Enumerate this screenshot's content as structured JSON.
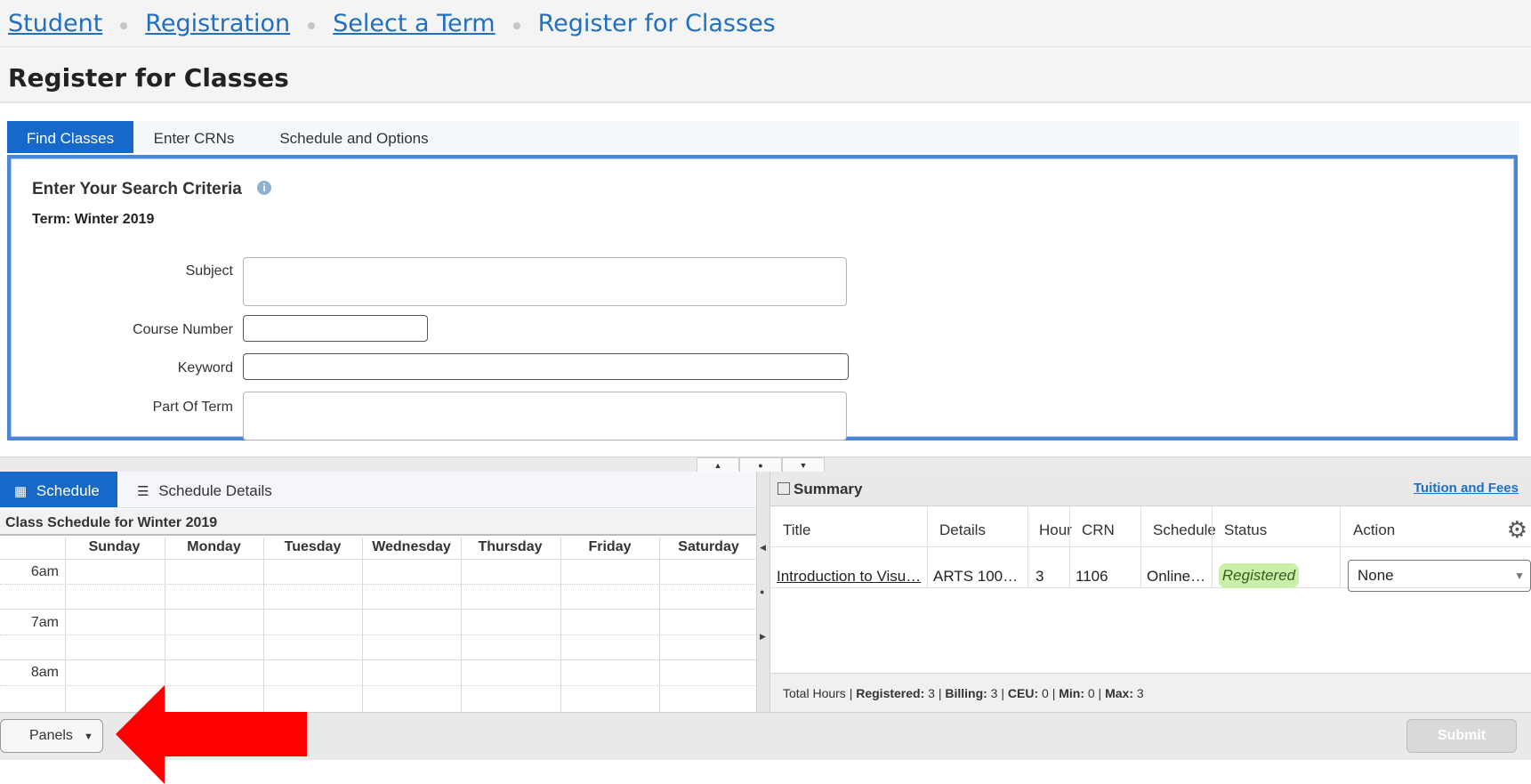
{
  "breadcrumb": {
    "items": [
      "Student",
      "Registration",
      "Select a Term",
      "Register for Classes"
    ]
  },
  "page": {
    "title": "Register for Classes"
  },
  "tabs": [
    {
      "label": "Find Classes",
      "active": true
    },
    {
      "label": "Enter CRNs",
      "active": false
    },
    {
      "label": "Schedule and Options",
      "active": false
    }
  ],
  "search": {
    "title": "Enter Your Search Criteria",
    "info_icon": "info-icon",
    "term": "Term: Winter 2019",
    "fields": {
      "subject": {
        "label": "Subject",
        "value": ""
      },
      "course_number": {
        "label": "Course Number",
        "value": ""
      },
      "keyword": {
        "label": "Keyword",
        "value": ""
      },
      "part_of_term": {
        "label": "Part Of Term",
        "value": ""
      }
    }
  },
  "schedule": {
    "tabs": [
      {
        "label": "Schedule",
        "icon": "calendar-icon",
        "active": true
      },
      {
        "label": "Schedule Details",
        "icon": "list-icon",
        "active": false
      }
    ],
    "title": "Class Schedule for Winter 2019",
    "days": [
      "Sunday",
      "Monday",
      "Tuesday",
      "Wednesday",
      "Thursday",
      "Friday",
      "Saturday"
    ],
    "times": [
      "6am",
      "7am",
      "8am"
    ]
  },
  "summary": {
    "title": "Summary",
    "tuition_link": "Tuition and Fees",
    "columns": [
      "Title",
      "Details",
      "Hour",
      "CRN",
      "Schedule",
      "Status",
      "Action"
    ],
    "rows": [
      {
        "title": "Introduction to Visu…",
        "details": "ARTS 100…",
        "hours": "3",
        "crn": "1106",
        "schedule": "Online…",
        "status": "Registered",
        "action": "None"
      }
    ],
    "totals": {
      "prefix": "Total Hours | ",
      "registered_label": "Registered:",
      "registered": " 3 | ",
      "billing_label": "Billing:",
      "billing": " 3 | ",
      "ceu_label": "CEU:",
      "ceu": " 0 | ",
      "min_label": "Min:",
      "min": " 0 | ",
      "max_label": "Max:",
      "max": " 3"
    }
  },
  "footer": {
    "panels_label": "Panels",
    "submit_label": "Submit"
  },
  "colors": {
    "accent": "#1668c9",
    "link": "#1f6fc2",
    "badge": "#c9f0a6",
    "arrow": "#ff0000"
  }
}
